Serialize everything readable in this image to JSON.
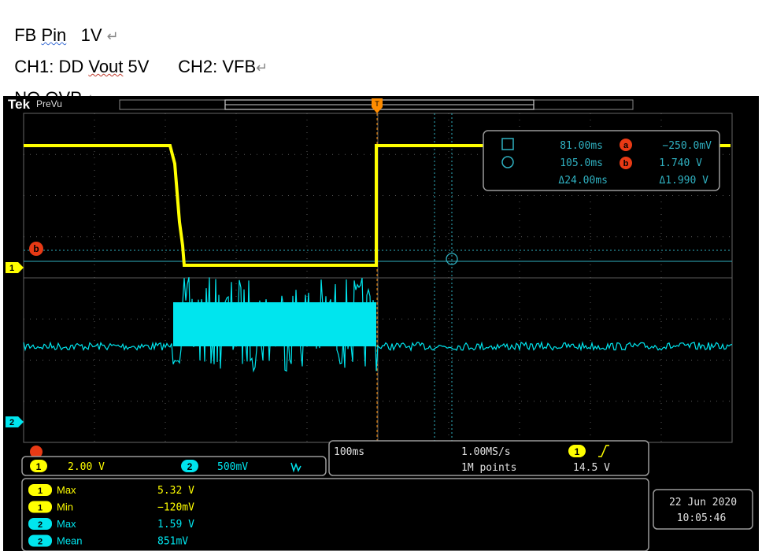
{
  "doc": {
    "line1_a": "FB ",
    "line1_b": "Pin",
    "line1_c": "   1V ",
    "line2_a": "CH1: DD ",
    "line2_b": "Vout",
    "line2_c": " 5V      CH2: VFB",
    "line3": "NO OVP",
    "para_mark": "↵"
  },
  "scope": {
    "brand": "Tek",
    "mode": "PreVu",
    "trigger_marker": "T",
    "cursor_a_label": "a",
    "cursor_b_label": "b",
    "ch1_marker": "1",
    "ch2_marker": "2",
    "cursor_readout": {
      "t1": "81.00ms",
      "t2": "105.0ms",
      "dt": "Δ24.00ms",
      "v_a": "−250.0mV",
      "v_b": "1.740 V",
      "dv": "Δ1.990 V"
    },
    "channels": {
      "ch1_label": "1",
      "ch1_scale": "2.00 V",
      "ch2_label": "2",
      "ch2_scale": "500mV",
      "ch2_bw_icon": "bandwidth-icon"
    },
    "timebase": {
      "time_div": "100ms",
      "sample_rate": "1.00MS/s",
      "record_length": "1M points",
      "trig_source": "1",
      "trig_slope_icon": "rising-edge-icon",
      "trig_level": "14.5 V"
    },
    "measurements": [
      {
        "ch": "1",
        "name": "Max",
        "value": "5.32 V"
      },
      {
        "ch": "1",
        "name": "Min",
        "value": "−120mV"
      },
      {
        "ch": "2",
        "name": "Max",
        "value": "1.59 V"
      },
      {
        "ch": "2",
        "name": "Mean",
        "value": "851mV"
      }
    ],
    "date": "22 Jun  2020",
    "time": "10:05:46"
  },
  "colors": {
    "ch1": "#ffff00",
    "ch2": "#00e5ee",
    "cursor": "#2fb0c0",
    "marker_red": "#e83a15",
    "trigger": "#ff8c00",
    "grid": "#5a5a5a",
    "panel_border": "#9a9a9a"
  }
}
